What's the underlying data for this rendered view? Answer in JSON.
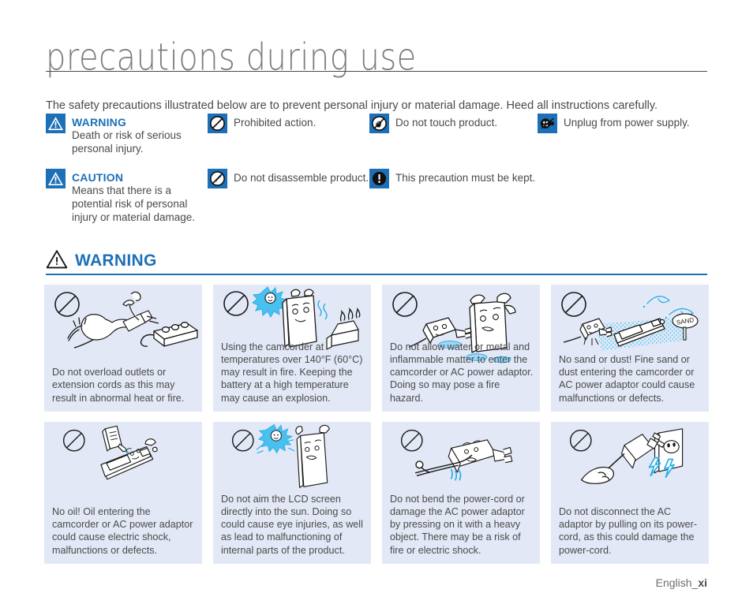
{
  "page": {
    "title": "precautions during use",
    "intro": "The safety precautions illustrated below are to prevent personal injury or material damage. Heed all instructions carefully.",
    "footer_label": "English_",
    "footer_page": "xi"
  },
  "colors": {
    "accent_blue": "#1d70b7",
    "icon_blue": "#1d70b7",
    "card_background": "#e3e8f6",
    "body_text": "#4a4a4a",
    "title_text": "#7d7d7d",
    "art_cyan": "#2ab0e8"
  },
  "legend": {
    "items": [
      {
        "icon": "warning-triangle-icon",
        "heading": "WARNING",
        "body": "Death or risk of serious personal injury."
      },
      {
        "icon": "caution-triangle-icon",
        "heading": "CAUTION",
        "body": "Means that there is a potential risk of personal injury or material damage."
      },
      {
        "icon": "prohibited-action-icon",
        "heading": "",
        "body": "Prohibited action."
      },
      {
        "icon": "do-not-disassemble-icon",
        "heading": "",
        "body": "Do not disassemble product."
      },
      {
        "icon": "do-not-touch-icon",
        "heading": "",
        "body": "Do not touch product."
      },
      {
        "icon": "must-be-kept-icon",
        "heading": "",
        "body": "This precaution must be kept."
      },
      {
        "icon": "unplug-power-icon",
        "heading": "",
        "body": "Unplug from power supply."
      }
    ]
  },
  "section": {
    "icon": "warning-triangle-outline-icon",
    "title": "WARNING"
  },
  "cards": [
    {
      "id": "overload-outlets",
      "art": "plug-overload-illustration",
      "badge": "prohibition-circle-icon",
      "text": "Do not overload outlets or extension cords as this may result in abnormal heat or fire."
    },
    {
      "id": "high-temperature",
      "art": "camcorder-heat-sun-illustration",
      "badge": "prohibition-circle-icon",
      "text": "Using the camcorder at temperatures over 140°F (60°C) may result in fire. Keeping the battery at a high temperature may cause an explosion."
    },
    {
      "id": "water-or-metal",
      "art": "water-metal-adaptor-illustration",
      "badge": "prohibition-circle-icon",
      "text": "Do not allow water or metal and inflammable matter to enter the camcorder or AC power adaptor. Doing so may pose a fire hazard."
    },
    {
      "id": "sand-or-dust",
      "art": "sand-dust-illustration",
      "badge": "prohibition-circle-icon",
      "text": "No sand or dust! Fine sand or dust entering the camcorder or AC power adaptor could cause malfunctions or defects.",
      "art_label": "SAND"
    },
    {
      "id": "no-oil",
      "art": "oil-bottle-camcorder-illustration",
      "badge": "prohibition-circle-icon",
      "text": "No oil! Oil entering the camcorder or AC power adaptor could cause electric shock, malfunctions or defects."
    },
    {
      "id": "lcd-into-sun",
      "art": "lcd-sun-illustration",
      "badge": "prohibition-circle-icon",
      "text": "Do not aim the LCD screen directly into the sun. Doing so could cause eye injuries, as well as lead to malfunctioning of internal parts of the product."
    },
    {
      "id": "bend-power-cord",
      "art": "bent-cord-adaptor-illustration",
      "badge": "prohibition-circle-icon",
      "text": "Do not bend the power-cord or damage the AC power adaptor by pressing on it with a heavy object. There may be a risk of fire or electric shock."
    },
    {
      "id": "disconnect-by-cord",
      "art": "pulling-cord-outlet-illustration",
      "badge": "prohibition-circle-icon",
      "text": "Do not disconnect the AC adaptor by pulling on its power-cord, as this could damage the power-cord."
    }
  ]
}
